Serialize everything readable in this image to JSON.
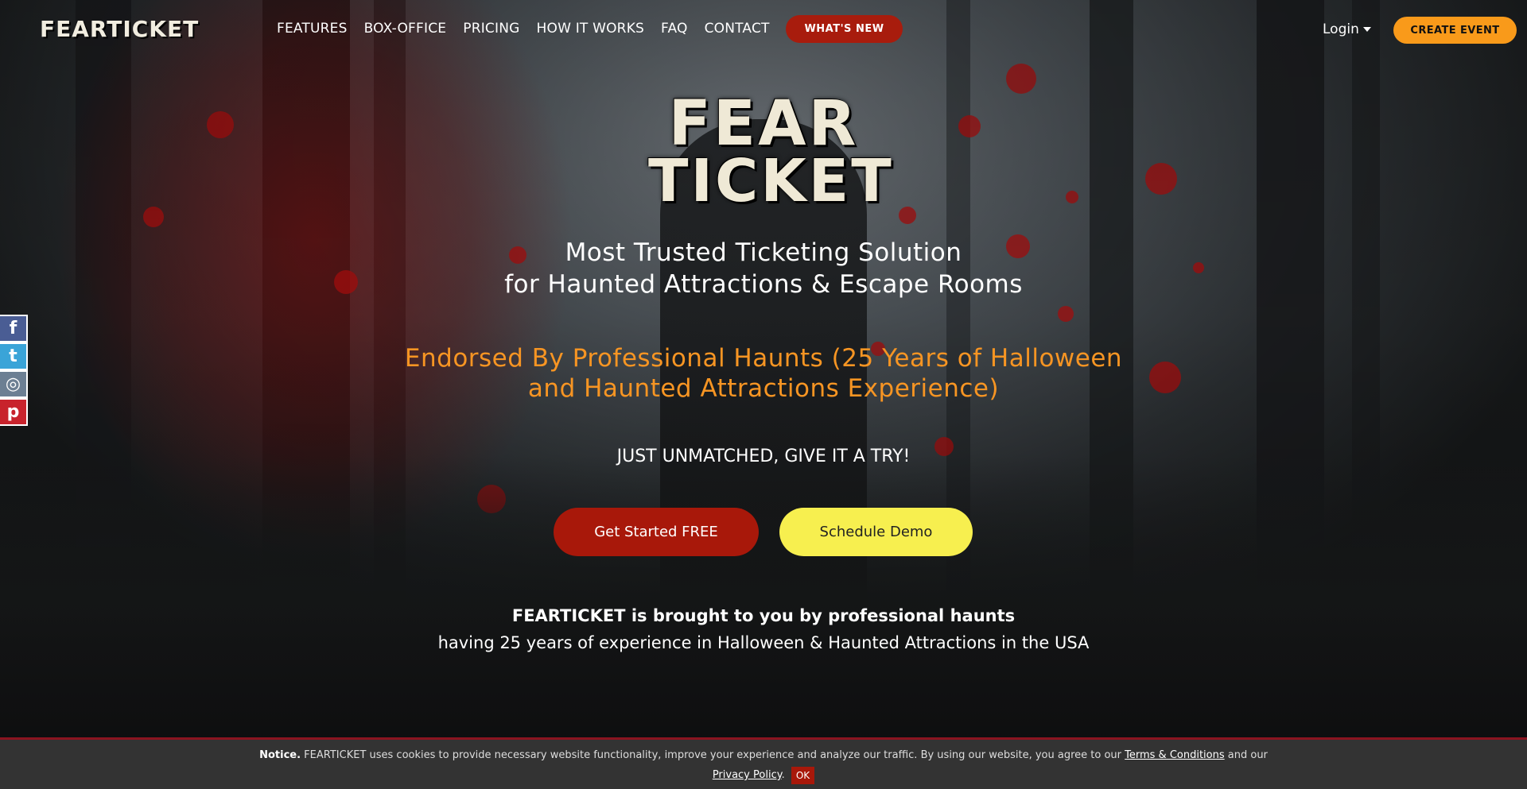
{
  "brand": {
    "logo_text": "FEARTICKET",
    "hero_logo_line1": "FEAR",
    "hero_logo_line2": "TICKET"
  },
  "nav": {
    "items": [
      {
        "label": "FEATURES"
      },
      {
        "label": "BOX-OFFICE"
      },
      {
        "label": "PRICING"
      },
      {
        "label": "HOW IT WORKS"
      },
      {
        "label": "FAQ"
      },
      {
        "label": "CONTACT"
      }
    ],
    "whats_new": "WHAT'S NEW",
    "login": "Login",
    "create_event": "CREATE EVENT"
  },
  "social": {
    "facebook": "f",
    "twitter": "t",
    "instagram": "◎",
    "pinterest": "p"
  },
  "hero": {
    "tagline_line1": "Most Trusted Ticketing Solution",
    "tagline_line2": "for Haunted Attractions & Escape Rooms",
    "endorsed_line1": "Endorsed By Professional Haunts (25 Years of Halloween",
    "endorsed_line2": "and Haunted Attractions Experience)",
    "try_text": "JUST UNMATCHED, GIVE IT A TRY!",
    "cta_start": "Get Started FREE",
    "cta_demo": "Schedule Demo",
    "brought_bold": "FEARTICKET",
    "brought_rest": " is brought to you by professional haunts",
    "brought_line2": "having 25 years of experience in Halloween & Haunted Attractions in the USA"
  },
  "cookie": {
    "notice_label": "Notice.",
    "text_before": " FEARTICKET uses cookies to provide necessary website functionality, improve your experience and analyze our traffic. By using our website, you agree to our ",
    "terms_link": "Terms & Conditions",
    "text_middle": " and our ",
    "privacy_link": "Privacy Policy",
    "text_after": ".",
    "ok": "OK"
  },
  "colors": {
    "accent_red": "#a8180a",
    "accent_orange": "#f99a1a",
    "accent_yellow": "#f7ef4f",
    "endorsed_orange": "#f79523"
  }
}
